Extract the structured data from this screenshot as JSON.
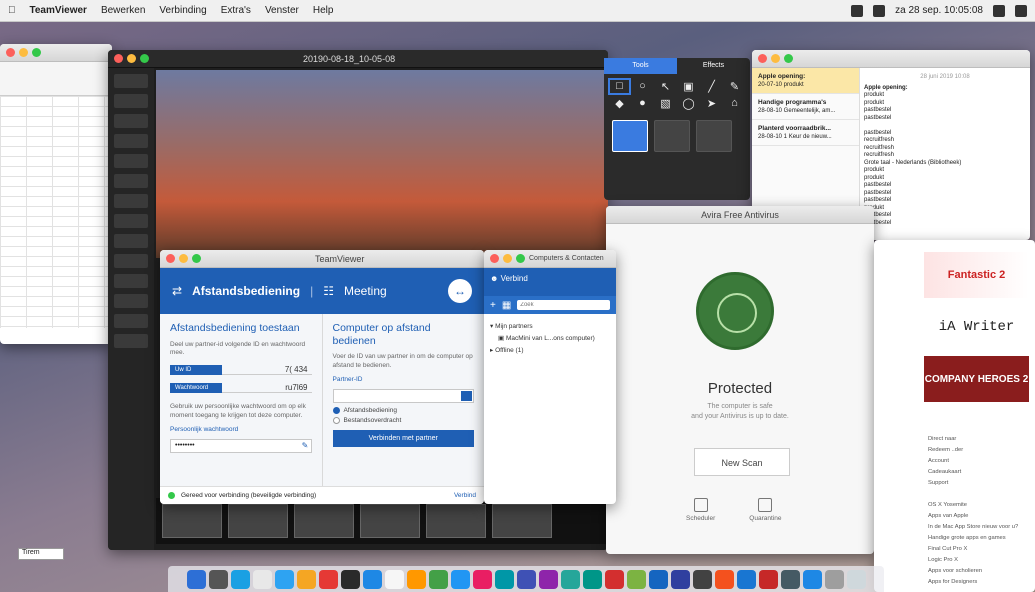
{
  "menubar": {
    "app": "TeamViewer",
    "items": [
      "Bewerken",
      "Verbinding",
      "Extra's",
      "Venster",
      "Help"
    ],
    "clock": "za 28 sep. 10:05:08"
  },
  "media_window": {
    "title": "20190-08-18_10-05-08"
  },
  "teamviewer": {
    "title": "TeamViewer",
    "tab_remote": "Afstandsbediening",
    "tab_meeting": "Meeting",
    "allow_heading": "Afstandsbediening toestaan",
    "allow_sub": "Deel uw partner-id volgende ID en wachtwoord mee.",
    "id_label": "Uw ID",
    "id_value": "7( 434",
    "pw_label": "Wachtwoord",
    "pw_value": "ru7l69",
    "personal_note": "Gebruik uw persoonlijke wachtwoord om op elk moment toegang te krijgen tot deze computer.",
    "personal_label": "Persoonlijk wachtwoord",
    "personal_value": "••••••••",
    "control_heading": "Computer op afstand bedienen",
    "control_sub": "Voer de ID van uw partner in om de computer op afstand te bedienen.",
    "partner_label": "Partner-ID",
    "opt_remote": "Afstandsbediening",
    "opt_transfer": "Bestandsoverdracht",
    "connect_button": "Verbinden met partner",
    "status": "Gereed voor verbinding (beveiligde verbinding)",
    "signin": "Verbind"
  },
  "contacts": {
    "title": "Computers & Contacten",
    "user": "Verbind",
    "search_placeholder": "Zoek",
    "my_partners": "Mijn partners",
    "device": "MacMini van L...ons computer)",
    "offline": "Offline (1)"
  },
  "tools": {
    "tab_tools": "Tools",
    "tab_effects": "Effects",
    "icons": [
      "□",
      "○",
      "↖",
      "▣",
      "╱",
      "✎",
      "◆",
      "●",
      "▧",
      "◯",
      "➤",
      "⌂"
    ]
  },
  "notes": {
    "notes": [
      {
        "title": "Apple opening:",
        "meta": "20-07-10 produkt"
      },
      {
        "title": "Handige programma's",
        "meta": "28-08-10 Gemeentelijk, am..."
      },
      {
        "title": "Planterd voorraadbrik...",
        "meta": "28-08-10 1 Keur de nieuw..."
      }
    ],
    "date": "28 juni 2019 10:08",
    "content_title": "Apple opening:",
    "content_lines": [
      "produkt",
      "produkt",
      "pastbestel",
      "pastbestel",
      "",
      "pastbestel",
      "recruitfresh",
      "recruitfresh",
      "recruitfresh",
      "Grote taal - Nederlands (Bibliotheek)",
      "produkt",
      "produkt",
      "pastbestel",
      "pastbestel",
      "pastbestel",
      "produkt",
      "pastbestel",
      "pastbestel"
    ]
  },
  "antivirus": {
    "title": "Avira Free Antivirus",
    "status": "Protected",
    "sub_line1": "The computer is safe",
    "sub_line2": "and your Antivirus is up to date.",
    "scan_button": "New Scan",
    "scheduler": "Scheduler",
    "quarantine": "Quarantine"
  },
  "store": {
    "tile1": "Fantastic 2",
    "tile2": "iA Writer",
    "tile3": "COMPANY HEROES 2",
    "links": [
      "Direct naar",
      "Redeem ..der",
      "Account",
      "Cadeaukaart",
      "Support",
      "",
      "OS X Yosemite",
      "Apps van Apple",
      "In de Mac App Store nieuw voor u?",
      "Handige grote apps en games",
      "Final Cut Pro X",
      "Logic Pro X",
      "Apps voor scholieren",
      "Apps for Designers"
    ]
  },
  "desktop_dropdown": "Tirem",
  "dock_colors": [
    "#2d6fd6",
    "#555",
    "#1aa0e3",
    "#e8e8e8",
    "#2ea3f2",
    "#f5a623",
    "#e53935",
    "#2a2a2a",
    "#1e88e5",
    "#f6f6f6",
    "#ff9800",
    "#43a047",
    "#2196f3",
    "#e91e63",
    "#0097a7",
    "#3f51b5",
    "#8e24aa",
    "#26a69a",
    "#009688",
    "#d32f2f",
    "#7cb342",
    "#1565c0",
    "#303f9f",
    "#424242",
    "#f4511e",
    "#1976d2",
    "#c62828",
    "#455a64",
    "#1e88e5",
    "#9e9e9e",
    "#cfd8dc"
  ]
}
